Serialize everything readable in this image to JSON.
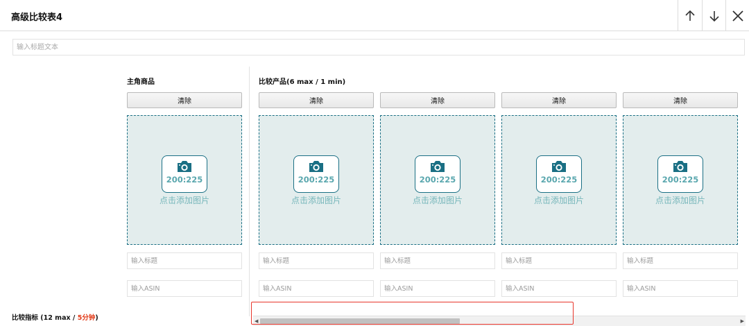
{
  "header": {
    "title": "高级比较表4",
    "up_icon": "arrow-up-icon",
    "down_icon": "arrow-down-icon",
    "close_icon": "close-icon"
  },
  "title_input": {
    "placeholder": "输入标题文本",
    "value": ""
  },
  "main_product": {
    "label": "主角商品",
    "clear_label": "清除",
    "ratio": "200:225",
    "add_image_text": "点击添加图片",
    "title_placeholder": "输入标题",
    "asin_placeholder": "输入ASIN"
  },
  "compare": {
    "label": "比较产品(6 max / 1 min)",
    "products": [
      {
        "clear_label": "清除",
        "ratio": "200:225",
        "add_image_text": "点击添加图片",
        "title_placeholder": "输入标题",
        "asin_placeholder": "输入ASIN"
      },
      {
        "clear_label": "清除",
        "ratio": "200:225",
        "add_image_text": "点击添加图片",
        "title_placeholder": "输入标题",
        "asin_placeholder": "输入ASIN"
      },
      {
        "clear_label": "清除",
        "ratio": "200:225",
        "add_image_text": "点击添加图片",
        "title_placeholder": "输入标题",
        "asin_placeholder": "输入ASIN"
      },
      {
        "clear_label": "清除",
        "ratio": "200:225",
        "add_image_text": "点击添加图片",
        "title_placeholder": "输入标题",
        "asin_placeholder": "输入ASIN"
      }
    ]
  },
  "metrics": {
    "label_prefix": "比较指标 (12 max / ",
    "label_accent": "5分钟",
    "label_suffix": ")"
  },
  "scrollbar": {
    "visible_fraction": 0.42
  },
  "colors": {
    "accent": "#1a6f84",
    "upload_bg": "#e3eded",
    "highlight": "#e8342a",
    "warning_text": "#e23c1a"
  },
  "icons": {
    "camera": "camera-icon"
  }
}
